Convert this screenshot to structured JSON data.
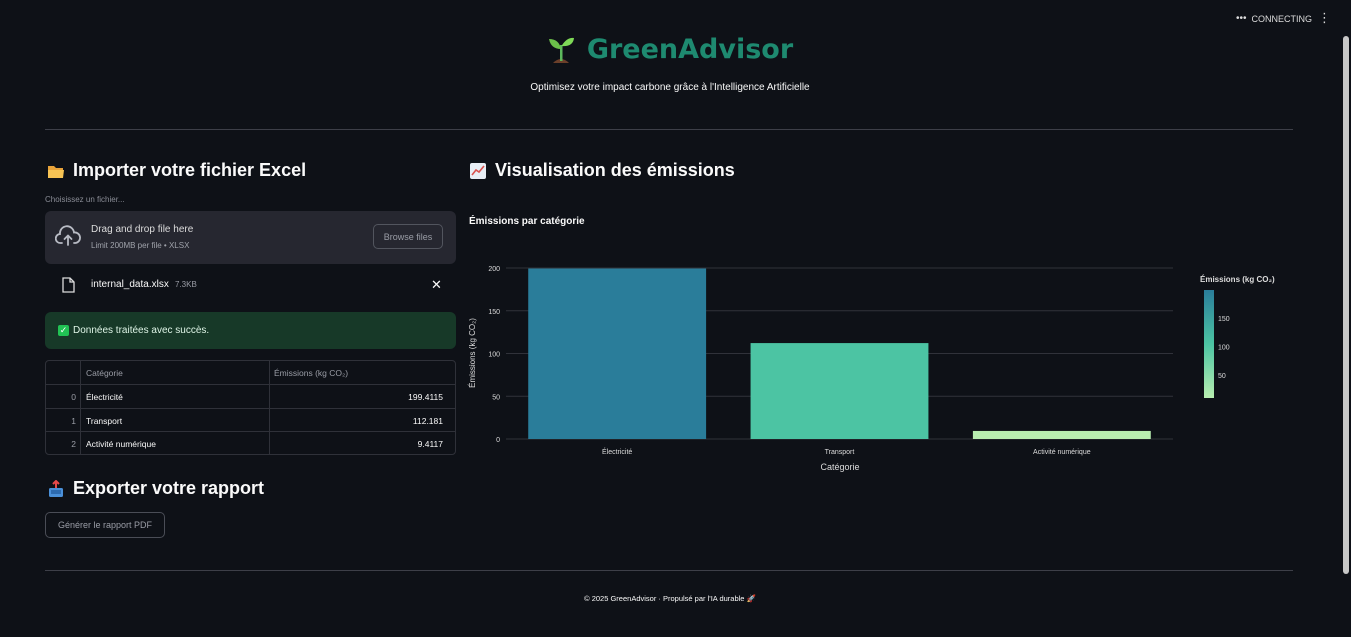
{
  "status": {
    "label": "CONNECTING"
  },
  "app": {
    "title": "GreenAdvisor",
    "subtitle": "Optimisez votre impact carbone grâce à l'Intelligence Artificielle"
  },
  "import_section": {
    "heading": "Importer votre fichier Excel",
    "file_label": "Choisissez un fichier...",
    "dropzone_text": "Drag and drop file here",
    "dropzone_limit": "Limit 200MB per file • XLSX",
    "browse_label": "Browse files",
    "uploaded_file": {
      "name": "internal_data.xlsx",
      "size": "7.3KB"
    },
    "success_message": "Données traitées avec succès."
  },
  "table": {
    "columns": [
      "Catégorie",
      "Émissions (kg CO₂)"
    ],
    "rows": [
      {
        "index": "0",
        "category": "Électricité",
        "value": "199.4115"
      },
      {
        "index": "1",
        "category": "Transport",
        "value": "112.181"
      },
      {
        "index": "2",
        "category": "Activité numérique",
        "value": "9.4117"
      }
    ]
  },
  "export_section": {
    "heading": "Exporter votre rapport",
    "button_label": "Générer le rapport PDF"
  },
  "viz_section": {
    "heading": "Visualisation des émissions"
  },
  "chart_data": {
    "type": "bar",
    "title": "Émissions par catégorie",
    "categories": [
      "Électricité",
      "Transport",
      "Activité numérique"
    ],
    "values": [
      199.4115,
      112.181,
      9.4117
    ],
    "xlabel": "Catégorie",
    "ylabel": "Émissions (kg CO₂)",
    "ylim": [
      0,
      200
    ],
    "yticks": [
      0,
      50,
      100,
      150,
      200
    ],
    "grid": true,
    "colors": [
      "#2a7d9a",
      "#4cc4a3",
      "#b8eeb0"
    ],
    "colorbar": {
      "title": "Émissions (kg CO₂)",
      "ticks": [
        50,
        100,
        150
      ],
      "range": [
        9.4117,
        199.4115
      ],
      "gradient": [
        "#b8eeb0",
        "#4cc4a3",
        "#2a7d9a"
      ]
    }
  },
  "footer": {
    "text": "© 2025 GreenAdvisor · Propulsé par l'IA durable 🚀"
  }
}
